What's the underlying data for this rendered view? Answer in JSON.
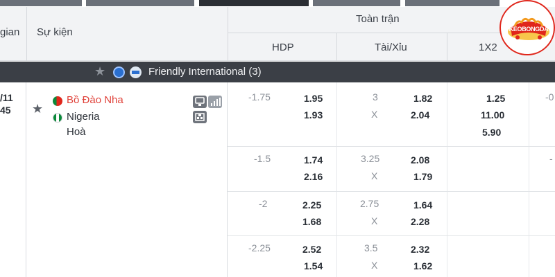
{
  "header": {
    "time_label": "gian",
    "event_label": "Sự kiện",
    "full_match_label": "Toàn trận",
    "hdp_label": "HDP",
    "ou_label": "Tài/Xỉu",
    "x12_label": "1X2"
  },
  "logo": {
    "text": "KEOBONGDA",
    "brand_color": "#e0261b"
  },
  "league": {
    "name": "Friendly International (3)",
    "star_icon": "star-icon",
    "icons": [
      "fifa-globe-icon",
      "fifa-badge-icon"
    ]
  },
  "match": {
    "date": "/11",
    "time": "45",
    "home": "Bồ Đào Nha",
    "away": "Nigeria",
    "draw": "Hoà",
    "home_color": "#e0423a"
  },
  "odds_rows": [
    {
      "hdp": "-1.75",
      "hdp_home": "1.95",
      "hdp_away": "1.93",
      "ou": "3",
      "ou_x": "X",
      "ou_over": "1.82",
      "ou_under": "2.04",
      "x12_1": "1.25",
      "x12_x": "11.00",
      "x12_2": "5.90",
      "extra": "-0"
    },
    {
      "hdp": "-1.5",
      "hdp_home": "1.74",
      "hdp_away": "2.16",
      "ou": "3.25",
      "ou_x": "X",
      "ou_over": "2.08",
      "ou_under": "1.79",
      "extra": "-"
    },
    {
      "hdp": "-2",
      "hdp_home": "2.25",
      "hdp_away": "1.68",
      "ou": "2.75",
      "ou_x": "X",
      "ou_over": "1.64",
      "ou_under": "2.28"
    },
    {
      "hdp": "-2.25",
      "hdp_home": "2.52",
      "hdp_away": "1.54",
      "ou": "3.5",
      "ou_x": "X",
      "ou_over": "2.32",
      "ou_under": "1.62"
    }
  ]
}
